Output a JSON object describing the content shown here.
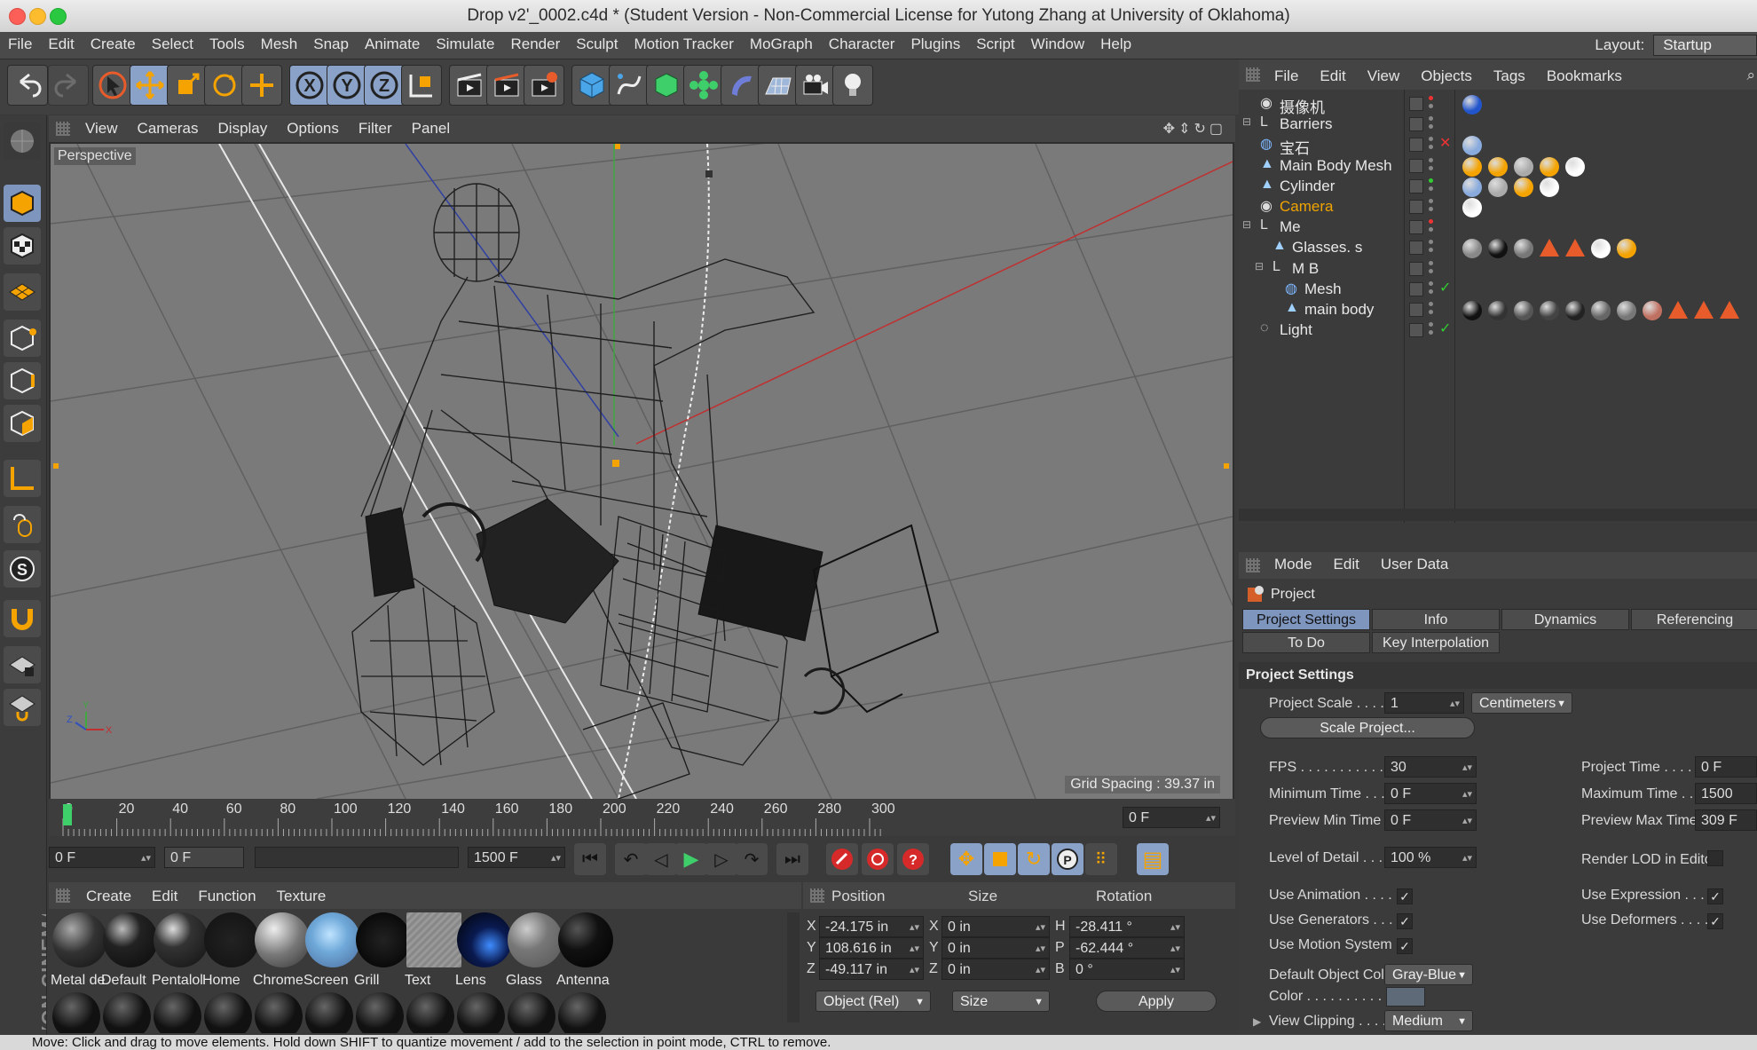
{
  "window": {
    "title": "Drop v2'_0002.c4d * (Student Version - Non-Commercial License for Yutong Zhang at University of Oklahoma)"
  },
  "menu": [
    "File",
    "Edit",
    "Create",
    "Select",
    "Tools",
    "Mesh",
    "Snap",
    "Animate",
    "Simulate",
    "Render",
    "Sculpt",
    "Motion Tracker",
    "MoGraph",
    "Character",
    "Plugins",
    "Script",
    "Window",
    "Help"
  ],
  "layout": {
    "label": "Layout:",
    "value": "Startup"
  },
  "viewport": {
    "menu": [
      "View",
      "Cameras",
      "Display",
      "Options",
      "Filter",
      "Panel"
    ],
    "label": "Perspective",
    "grid_spacing": "Grid Spacing : 39.37 in"
  },
  "timeline": {
    "ticks": [
      "0",
      "20",
      "40",
      "60",
      "80",
      "100",
      "120",
      "140",
      "160",
      "180",
      "200",
      "220",
      "240",
      "260",
      "280",
      "300"
    ],
    "current_frame": "0 F"
  },
  "transport": {
    "start_field": "0 F",
    "slider_field": "0 F",
    "end_field": "1500 F"
  },
  "materials": {
    "menu": [
      "Create",
      "Edit",
      "Function",
      "Texture"
    ],
    "items": [
      {
        "name": "Metal de"
      },
      {
        "name": "Default"
      },
      {
        "name": "Pentalol"
      },
      {
        "name": "Home"
      },
      {
        "name": "Chrome"
      },
      {
        "name": "Screen"
      },
      {
        "name": "Grill"
      },
      {
        "name": "Text"
      },
      {
        "name": "Lens"
      },
      {
        "name": "Glass"
      },
      {
        "name": "Antenna"
      }
    ],
    "brand": "MAXON CINEMA 4D"
  },
  "coordinates": {
    "headers": {
      "position": "Position",
      "size": "Size",
      "rotation": "Rotation"
    },
    "rows": [
      {
        "axis": "X",
        "pos": "-24.175 in",
        "saxis": "X",
        "size": "0 in",
        "raxis": "H",
        "rot": "-28.411 °"
      },
      {
        "axis": "Y",
        "pos": "108.616 in",
        "saxis": "Y",
        "size": "0 in",
        "raxis": "P",
        "rot": "-62.444 °"
      },
      {
        "axis": "Z",
        "pos": "-49.117 in",
        "saxis": "Z",
        "size": "0 in",
        "raxis": "B",
        "rot": "0 °"
      }
    ],
    "mode": "Object (Rel)",
    "size_mode": "Size",
    "apply": "Apply"
  },
  "object_manager": {
    "menu": [
      "File",
      "Edit",
      "View",
      "Objects",
      "Tags",
      "Bookmarks"
    ],
    "objects": [
      {
        "name": "摄像机",
        "indent": 0,
        "highlight": false
      },
      {
        "name": "Barriers",
        "indent": 0,
        "highlight": false
      },
      {
        "name": "宝石",
        "indent": 0,
        "highlight": false
      },
      {
        "name": "Main Body Mesh",
        "indent": 0,
        "highlight": false
      },
      {
        "name": "Cylinder",
        "indent": 0,
        "highlight": false
      },
      {
        "name": "Camera",
        "indent": 0,
        "highlight": true
      },
      {
        "name": "Me",
        "indent": 0,
        "highlight": false
      },
      {
        "name": "Glasses. s",
        "indent": 1,
        "highlight": false
      },
      {
        "name": "M B",
        "indent": 1,
        "highlight": false
      },
      {
        "name": "Mesh",
        "indent": 2,
        "highlight": false
      },
      {
        "name": "main body",
        "indent": 2,
        "highlight": false
      },
      {
        "name": "Light",
        "indent": 0,
        "highlight": false
      }
    ]
  },
  "attributes": {
    "menu": [
      "Mode",
      "Edit",
      "User Data"
    ],
    "object": "Project",
    "tabs_row1": [
      "Project Settings",
      "Info",
      "Dynamics",
      "Referencing"
    ],
    "tabs_row2": [
      "To Do",
      "Key Interpolation"
    ],
    "section": "Project Settings",
    "project_scale": {
      "label": "Project Scale . . . . . . .",
      "value": "1",
      "unit": "Centimeters"
    },
    "scale_project_btn": "Scale Project...",
    "left": [
      {
        "label": "FPS . . . . . . . . . . . . . . .",
        "value": "30"
      },
      {
        "label": "Minimum Time . . . . .",
        "value": "0 F"
      },
      {
        "label": "Preview Min Time . .",
        "value": "0 F"
      },
      {
        "label": "Level of Detail . . . . .",
        "value": "100 %"
      }
    ],
    "right": [
      {
        "label": "Project Time . . . . . . .",
        "value": "0 F"
      },
      {
        "label": "Maximum Time . . . .",
        "value": "1500"
      },
      {
        "label": "Preview Max Time . .",
        "value": "309 F"
      }
    ],
    "render_lod": "Render LOD in Editor",
    "checks_left": [
      "Use Animation . . . . .",
      "Use Generators . . . .",
      "Use Motion System"
    ],
    "checks_right": [
      "Use Expression . . . .",
      "Use Deformers . . . . ."
    ],
    "default_color": {
      "label": "Default Object Color",
      "value": "Gray-Blue"
    },
    "color_label": "Color . . . . . . . . . . .",
    "view_clipping": {
      "label": "View Clipping . . . . . .",
      "value": "Medium"
    }
  },
  "status": "Move: Click and drag to move elements. Hold down SHIFT to quantize movement / add to the selection in point mode, CTRL to remove."
}
